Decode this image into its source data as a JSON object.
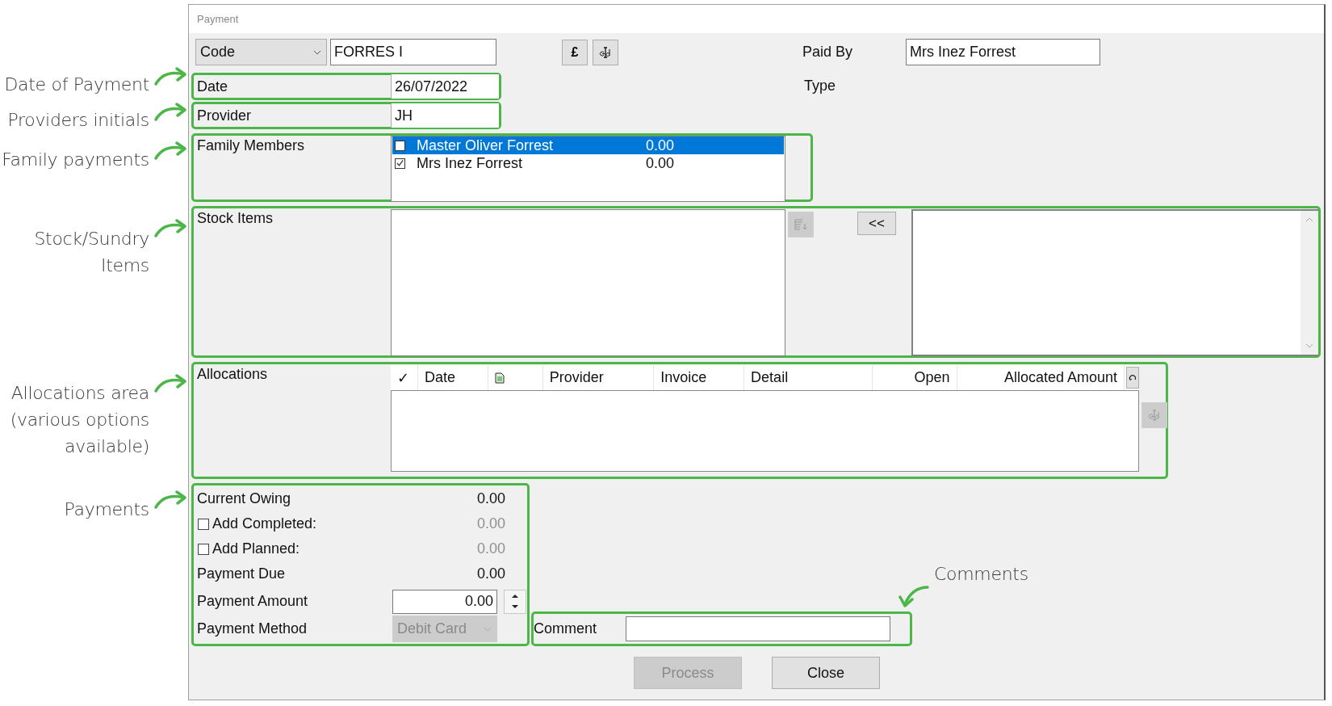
{
  "window": {
    "title": "Payment"
  },
  "code_selector": {
    "value": "Code"
  },
  "code_field": {
    "value": "FORRES I"
  },
  "toolbar_buttons": [
    {
      "kind": "text",
      "label": "£"
    },
    {
      "kind": "icon"
    }
  ],
  "paid_by": {
    "label": "Paid By",
    "value": "Mrs Inez Forrest"
  },
  "type": {
    "label": "Type"
  },
  "date": {
    "label": "Date",
    "value": "26/07/2022"
  },
  "provider": {
    "label": "Provider",
    "value": "JH"
  },
  "family_members": {
    "label": "Family Members",
    "items": [
      {
        "name": "Master Oliver Forrest",
        "amount": "0.00",
        "checked": false,
        "selected": true
      },
      {
        "name": "Mrs Inez Forrest",
        "amount": "0.00",
        "checked": true,
        "selected": false
      }
    ]
  },
  "stock_items": {
    "label": "Stock Items",
    "move_button": "<<"
  },
  "allocations": {
    "label": "Allocations",
    "columns": [
      {
        "kind": "text",
        "label": "✓"
      },
      {
        "kind": "text",
        "label": "Date"
      },
      {
        "kind": "icon"
      },
      {
        "kind": "text",
        "label": "Provider"
      },
      {
        "kind": "text",
        "label": "Invoice"
      },
      {
        "kind": "text",
        "label": "Detail"
      },
      {
        "kind": "number",
        "label": "Open"
      },
      {
        "kind": "number",
        "label": "Allocated Amount"
      }
    ]
  },
  "payments": {
    "rows": [
      {
        "kind": "value",
        "label": "Current Owing",
        "value": "0.00"
      },
      {
        "kind": "checkbox",
        "label": "Add Completed:",
        "checked": false,
        "value": "0.00",
        "disabled": true
      },
      {
        "kind": "checkbox",
        "label": "Add Planned:",
        "checked": false,
        "value": "0.00",
        "disabled": true
      },
      {
        "kind": "value",
        "label": "Payment Due",
        "value": "0.00"
      }
    ],
    "amount": {
      "label": "Payment Amount",
      "value": "0.00"
    },
    "method": {
      "label": "Payment Method",
      "value": "Debit Card",
      "disabled": true
    }
  },
  "comment": {
    "label": "Comment"
  },
  "buttons": [
    {
      "label": "Process",
      "disabled": true
    },
    {
      "label": "Close",
      "disabled": false
    }
  ],
  "annotations": [
    {
      "lines": [
        "Date of Payment"
      ]
    },
    {
      "lines": [
        "Providers initials"
      ]
    },
    {
      "lines": [
        "Family payments"
      ]
    },
    {
      "lines": [
        "Stock/Sundry",
        "Items"
      ]
    },
    {
      "lines": [
        "Allocations area",
        "(various options",
        "available)"
      ]
    },
    {
      "lines": [
        "Payments"
      ]
    },
    {
      "lines": [
        "Comments"
      ]
    }
  ]
}
